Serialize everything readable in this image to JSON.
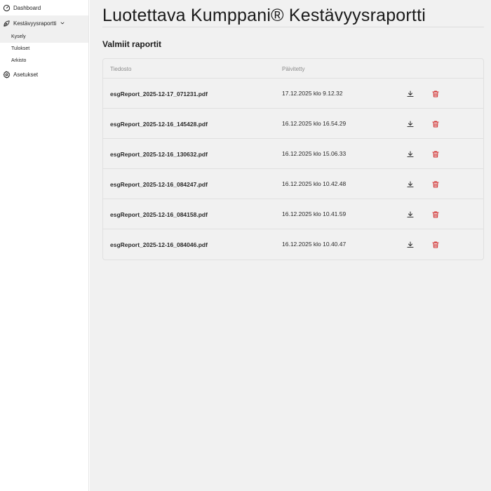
{
  "sidebar": {
    "items": [
      {
        "label": "Dashboard",
        "icon": "dashboard-gauge-icon"
      },
      {
        "label": "Kestävyysraportti",
        "icon": "leaf-icon"
      },
      {
        "label": "Asetukset",
        "icon": "gear-icon"
      }
    ],
    "subitems": [
      {
        "label": "Kysely"
      },
      {
        "label": "Tulokset"
      },
      {
        "label": "Arkisto"
      }
    ]
  },
  "page": {
    "title": "Luotettava Kumppani® Kestävyysraportti",
    "section_title": "Valmiit raportit"
  },
  "table": {
    "headers": {
      "file": "Tiedosto",
      "updated": "Päivitetty"
    },
    "rows": [
      {
        "file": "esgReport_2025-12-17_071231.pdf",
        "updated": "17.12.2025 klo 9.12.32"
      },
      {
        "file": "esgReport_2025-12-16_145428.pdf",
        "updated": "16.12.2025 klo 16.54.29"
      },
      {
        "file": "esgReport_2025-12-16_130632.pdf",
        "updated": "16.12.2025 klo 15.06.33"
      },
      {
        "file": "esgReport_2025-12-16_084247.pdf",
        "updated": "16.12.2025 klo 10.42.48"
      },
      {
        "file": "esgReport_2025-12-16_084158.pdf",
        "updated": "16.12.2025 klo 10.41.59"
      },
      {
        "file": "esgReport_2025-12-16_084046.pdf",
        "updated": "16.12.2025 klo 10.40.47"
      }
    ]
  },
  "colors": {
    "accent_delete": "#d32f2f",
    "main_bg": "#f1f1f1"
  }
}
